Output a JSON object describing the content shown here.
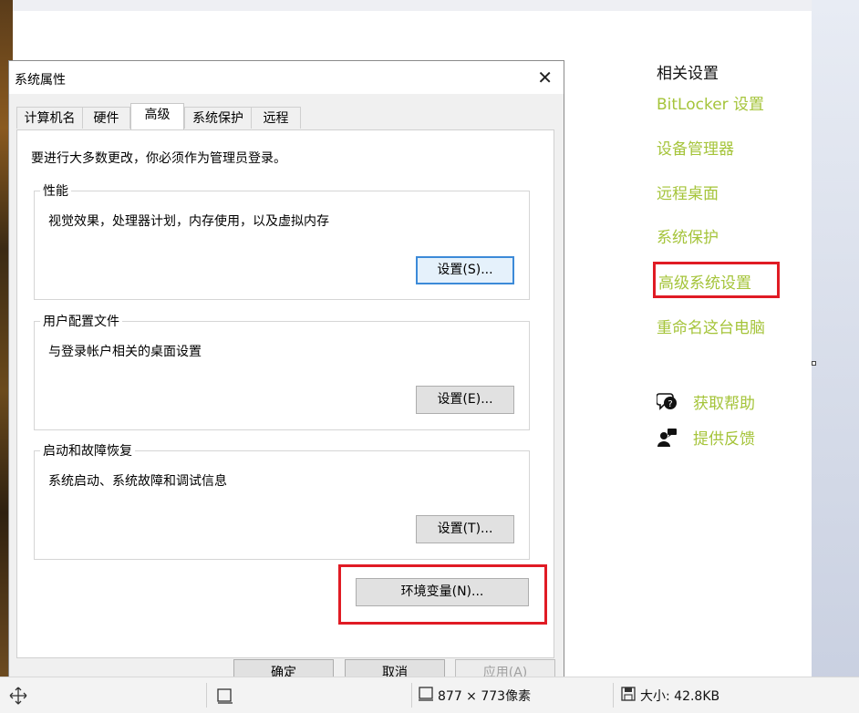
{
  "settings": {
    "related_heading": "相关设置",
    "links": [
      {
        "label": "BitLocker 设置"
      },
      {
        "label": "设备管理器"
      },
      {
        "label": "远程桌面"
      },
      {
        "label": "系统保护"
      },
      {
        "label": "高级系统设置"
      },
      {
        "label": "重命名这台电脑"
      }
    ],
    "help": {
      "get_help": "获取帮助",
      "feedback": "提供反馈"
    },
    "accent_color": "#a5c43a",
    "highlight_color": "#e01b24"
  },
  "dialog": {
    "title": "系统属性",
    "close": "✕",
    "tabs": [
      {
        "label": "计算机名"
      },
      {
        "label": "硬件"
      },
      {
        "label": "高级"
      },
      {
        "label": "系统保护"
      },
      {
        "label": "远程"
      }
    ],
    "active_tab": "高级",
    "intro": "要进行大多数更改，你必须作为管理员登录。",
    "performance": {
      "legend": "性能",
      "desc": "视觉效果，处理器计划，内存使用，以及虚拟内存",
      "button": "设置(S)..."
    },
    "profiles": {
      "legend": "用户配置文件",
      "desc": "与登录帐户相关的桌面设置",
      "button": "设置(E)..."
    },
    "startup": {
      "legend": "启动和故障恢复",
      "desc": "系统启动、系统故障和调试信息",
      "button": "设置(T)..."
    },
    "env_button": "环境变量(N)...",
    "ok": "确定",
    "cancel": "取消",
    "apply": "应用(A)"
  },
  "statusbar": {
    "dimensions": "877 × 773像素",
    "size": "大小: 42.8KB"
  }
}
